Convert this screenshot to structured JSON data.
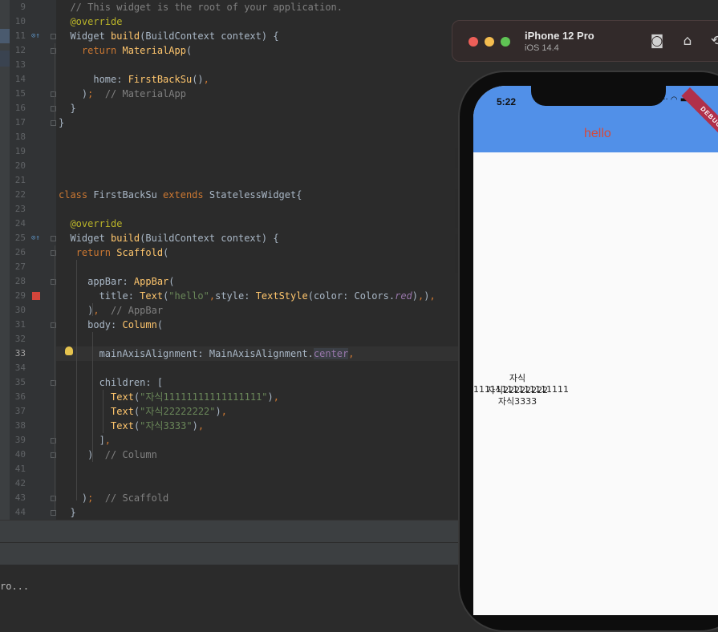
{
  "editor": {
    "lines": [
      {
        "num": "9",
        "html": "  <span class='cmt'>// This widget is the root of your application.</span>"
      },
      {
        "num": "10",
        "html": "  <span class='ann'>@override</span>"
      },
      {
        "num": "11",
        "html": "  Widget <span class='fn'>build</span>(BuildContext context) {"
      },
      {
        "num": "12",
        "html": "    <span class='kw'>return</span> <span class='fn'>MaterialApp</span>("
      },
      {
        "num": "13",
        "html": ""
      },
      {
        "num": "14",
        "html": "      home: <span class='fn'>FirstBackSu</span>()<span class='kw'>,</span>"
      },
      {
        "num": "15",
        "html": "    )<span class='kw'>;</span>  <span class='cmt'>// MaterialApp</span>"
      },
      {
        "num": "16",
        "html": "  }"
      },
      {
        "num": "17",
        "html": "}"
      },
      {
        "num": "18",
        "html": ""
      },
      {
        "num": "19",
        "html": ""
      },
      {
        "num": "20",
        "html": ""
      },
      {
        "num": "21",
        "html": ""
      },
      {
        "num": "22",
        "html": "<span class='kw'>class</span> FirstBackSu <span class='kw'>extends</span> StatelessWidget{"
      },
      {
        "num": "23",
        "html": ""
      },
      {
        "num": "24",
        "html": "  <span class='ann'>@override</span>"
      },
      {
        "num": "25",
        "html": "  Widget <span class='fn'>build</span>(BuildContext context) {"
      },
      {
        "num": "26",
        "html": "   <span class='kw'>return</span> <span class='fn'>Scaffold</span>("
      },
      {
        "num": "27",
        "html": ""
      },
      {
        "num": "28",
        "html": "     appBar: <span class='fn'>AppBar</span>("
      },
      {
        "num": "29",
        "html": "       title: <span class='fn'>Text</span>(<span class='str'>\"hello\"</span><span class='kw'>,</span>style: <span class='fn'>TextStyle</span>(color: Colors.<span class='pur'>red</span>)<span class='kw'>,</span>)<span class='kw'>,</span>"
      },
      {
        "num": "30",
        "html": "     )<span class='kw'>,</span>  <span class='cmt'>// AppBar</span>"
      },
      {
        "num": "31",
        "html": "     body: <span class='fn'>Column</span>("
      },
      {
        "num": "32",
        "html": ""
      },
      {
        "num": "33",
        "html": "       mainAxisAlignment: MainAxisAlignment.<span class='center-hl'>center</span><span class='kw'>,</span>"
      },
      {
        "num": "34",
        "html": ""
      },
      {
        "num": "35",
        "html": "       children: ["
      },
      {
        "num": "36",
        "html": "         <span class='fn'>Text</span>(<span class='str'>\"자식11111111111111111\"</span>)<span class='kw'>,</span>"
      },
      {
        "num": "37",
        "html": "         <span class='fn'>Text</span>(<span class='str'>\"자식22222222\"</span>)<span class='kw'>,</span>"
      },
      {
        "num": "38",
        "html": "         <span class='fn'>Text</span>(<span class='str'>\"자식3333\"</span>)<span class='kw'>,</span>"
      },
      {
        "num": "39",
        "html": "       ]<span class='kw'>,</span>"
      },
      {
        "num": "40",
        "html": "     )  <span class='cmt'>// Column</span>"
      },
      {
        "num": "41",
        "html": ""
      },
      {
        "num": "42",
        "html": ""
      },
      {
        "num": "43",
        "html": "    )<span class='kw'>;</span>  <span class='cmt'>// Scaffold</span>"
      },
      {
        "num": "44",
        "html": "  }"
      }
    ],
    "active_line": "33"
  },
  "status": {
    "bottom_text": "ro..."
  },
  "simulator": {
    "device_name": "iPhone 12 Pro",
    "os_version": "iOS 14.4",
    "time": "5:22",
    "appbar_title": "hello",
    "debug_banner": "DEBUG",
    "column_items": [
      "자식11111111111111111",
      "자식22222222",
      "자식3333"
    ],
    "icons": [
      "screenshot-icon",
      "home-icon",
      "rotate-icon"
    ]
  },
  "colors": {
    "appbar": "#5190e8",
    "title_red": "#d44a3c",
    "traffic_red": "#ed5f58",
    "traffic_yellow": "#f4bd4f",
    "traffic_green": "#5fc454"
  }
}
